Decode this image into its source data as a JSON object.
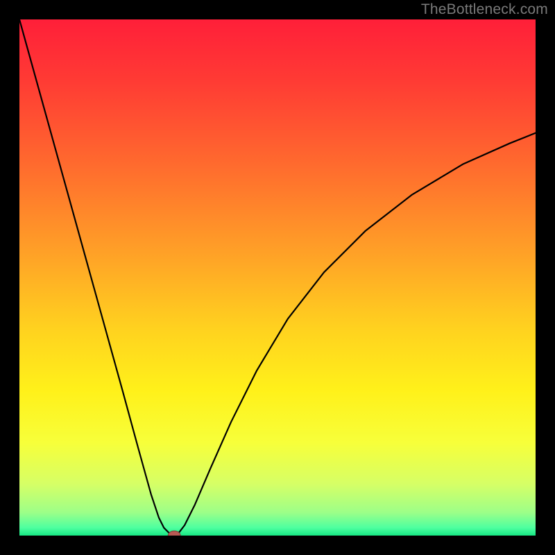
{
  "watermark": "TheBottleneck.com",
  "colors": {
    "frame": "#000000",
    "curve": "#000000",
    "marker_fill": "#b85a54",
    "marker_stroke": "#7a3c38",
    "gradient_stops": [
      {
        "offset": 0.0,
        "color": "#ff1f39"
      },
      {
        "offset": 0.12,
        "color": "#ff3b34"
      },
      {
        "offset": 0.28,
        "color": "#ff6a2e"
      },
      {
        "offset": 0.45,
        "color": "#ffa027"
      },
      {
        "offset": 0.6,
        "color": "#ffd21f"
      },
      {
        "offset": 0.72,
        "color": "#fff11a"
      },
      {
        "offset": 0.82,
        "color": "#f7ff3a"
      },
      {
        "offset": 0.9,
        "color": "#d6ff66"
      },
      {
        "offset": 0.955,
        "color": "#9dff88"
      },
      {
        "offset": 0.985,
        "color": "#4dffa0"
      },
      {
        "offset": 1.0,
        "color": "#17e884"
      }
    ]
  },
  "chart_data": {
    "type": "line",
    "title": "",
    "xlabel": "",
    "ylabel": "",
    "xlim": [
      0,
      1
    ],
    "ylim": [
      0,
      1
    ],
    "series": [
      {
        "name": "curve",
        "x": [
          0.0,
          0.05,
          0.1,
          0.15,
          0.2,
          0.23,
          0.255,
          0.27,
          0.28,
          0.29,
          0.295,
          0.3,
          0.305,
          0.31,
          0.32,
          0.34,
          0.37,
          0.41,
          0.46,
          0.52,
          0.59,
          0.67,
          0.76,
          0.86,
          0.95,
          1.0
        ],
        "y": [
          1.0,
          0.82,
          0.64,
          0.46,
          0.28,
          0.17,
          0.08,
          0.035,
          0.015,
          0.005,
          0.002,
          0.0,
          0.002,
          0.007,
          0.02,
          0.06,
          0.13,
          0.22,
          0.32,
          0.42,
          0.51,
          0.59,
          0.66,
          0.72,
          0.76,
          0.78
        ]
      }
    ],
    "marker": {
      "x": 0.3,
      "y": 0.0,
      "rx": 0.012,
      "ry": 0.009
    }
  }
}
